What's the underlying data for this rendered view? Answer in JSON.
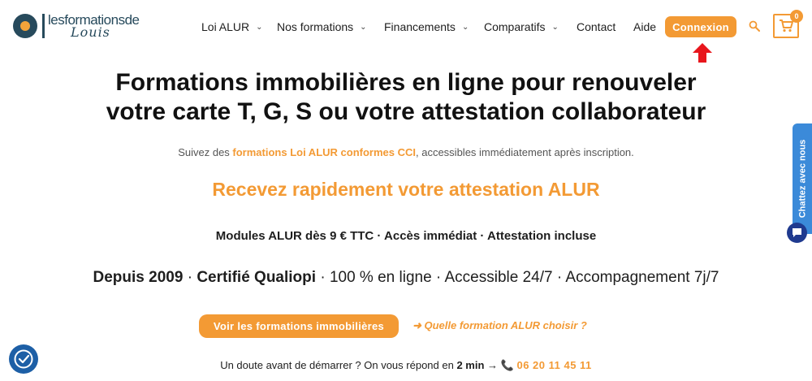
{
  "logo": {
    "line1": "lesformationsde",
    "line2": "Louis"
  },
  "nav": [
    {
      "label": "Loi ALUR",
      "has_dropdown": true
    },
    {
      "label": "Nos formations",
      "has_dropdown": true
    },
    {
      "label": "Financements",
      "has_dropdown": true
    },
    {
      "label": "Comparatifs",
      "has_dropdown": true
    },
    {
      "label": "Contact",
      "has_dropdown": false
    },
    {
      "label": "Aide",
      "has_dropdown": false
    }
  ],
  "header": {
    "connexion_label": "Connexion",
    "cart_count": "0"
  },
  "icons": {
    "search": "search-icon",
    "cart": "cart-icon",
    "arrow": "red-up-arrow-icon",
    "chat": "chat-icon",
    "accessibility": "accessibility-icon"
  },
  "hero": {
    "title_line1": "Formations immobilières en ligne pour renouveler",
    "title_line2": "votre carte T, G, S ou votre attestation collaborateur",
    "sub_prefix": "Suivez des ",
    "sub_highlight": "formations Loi ALUR conformes CCI",
    "sub_suffix": ", accessibles immédiatement après inscription.",
    "orange_heading": "Recevez rapidement votre attestation ALUR",
    "modules": "Modules ALUR dès 9 € TTC · Accès immédiat · Attestation incluse",
    "trust_b1": "Depuis 2009",
    "trust_sep1": " · ",
    "trust_b2": "Certifié Qualiopi",
    "trust_rest": " · 100 % en ligne · Accessible 24/7 · Accompagnement 7j/7"
  },
  "cta": {
    "primary_label": "Voir les formations immobilières",
    "secondary_label": "➜ Quelle formation ALUR choisir ?"
  },
  "doubt": {
    "prefix": "Un doute avant de démarrer ? On vous répond en ",
    "time": "2 min",
    "arrow": " → ",
    "phone_icon": "📞",
    "phone": "06 20 11 45 11"
  },
  "chat": {
    "tab_label": "Chattez avec nous"
  },
  "colors": {
    "accent": "#f39a34",
    "brand_dark": "#274a5c",
    "chat_blue": "#3b8ad9",
    "arrow_red": "#e8161c"
  }
}
